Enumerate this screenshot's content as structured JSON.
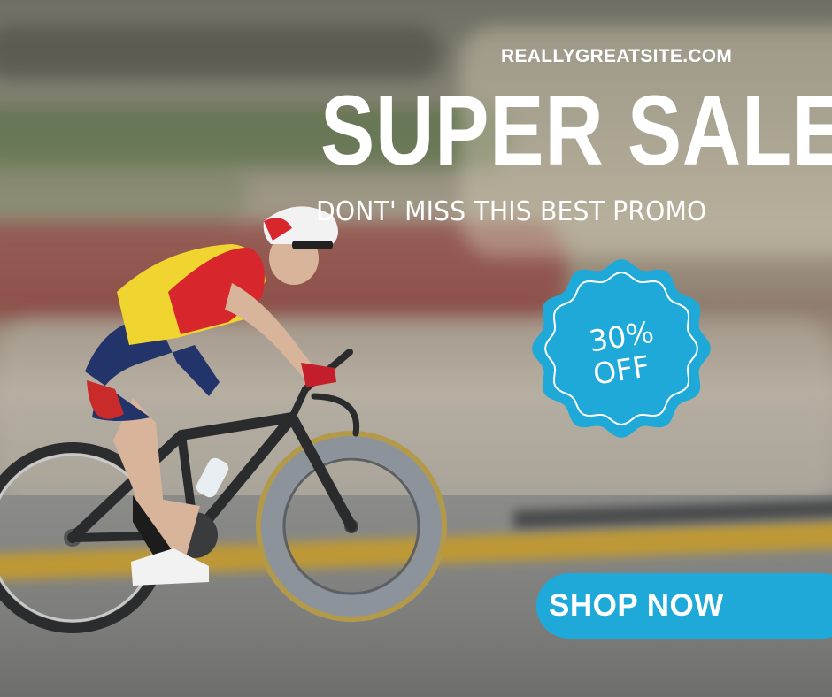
{
  "website": "REALLYGREATSITE.COM",
  "headline": "SUPER SALE",
  "subheadline": "DONT' MISS THIS BEST PROMO",
  "badge": {
    "line1": "30%",
    "line2": "OFF",
    "color": "#1fa9d8"
  },
  "cta": {
    "label": "SHOP NOW",
    "color": "#1fa9d8"
  },
  "photo": {
    "subject": "cyclist-on-road-bike"
  },
  "colors": {
    "text": "#ffffff",
    "accent": "#1fa9d8"
  }
}
